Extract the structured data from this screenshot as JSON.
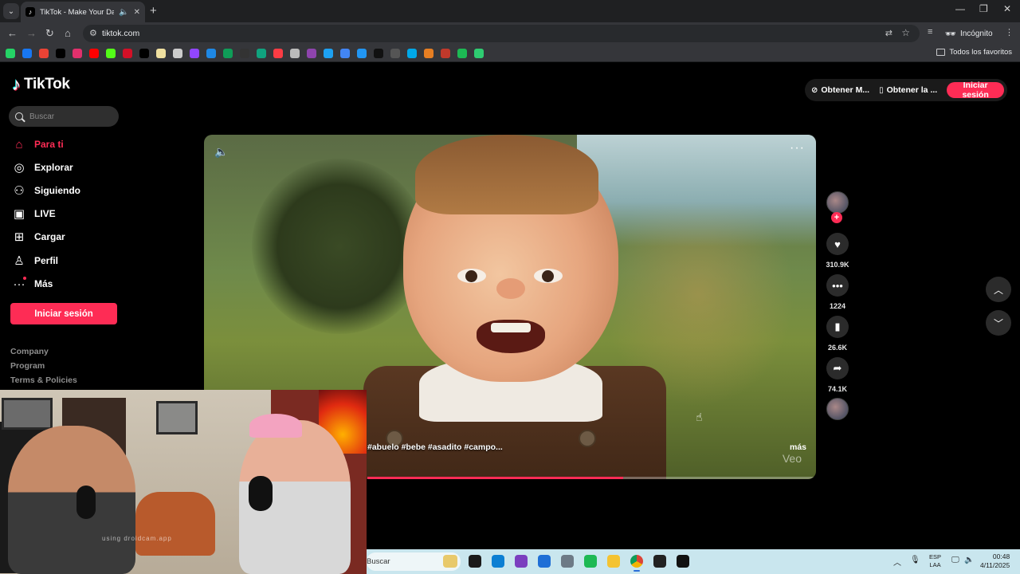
{
  "browser": {
    "tab_title": "TikTok - Make Your Day",
    "url": "tiktok.com",
    "profile_label": "Incógnito",
    "all_bookmarks_label": "Todos los favoritos",
    "bookmark_colors": [
      "#25d366",
      "#1877f2",
      "#ea4335",
      "#000000",
      "#e1306c",
      "#ff0000",
      "#53fc18",
      "#d31027",
      "#000000",
      "#f0e0a0",
      "#cccccc",
      "#9146ff",
      "#1e88e5",
      "#0f9d58",
      "#333333",
      "#10a37f",
      "#fc3c44",
      "#bbbbbb",
      "#8e44ad",
      "#1da1f2",
      "#4285f4",
      "#2196f3",
      "#111111",
      "#555555",
      "#00a8e8",
      "#e67e22",
      "#c0392b",
      "#1db954",
      "#2ecc71"
    ]
  },
  "tiktok": {
    "brand": "TikTok",
    "search_placeholder": "Buscar",
    "menu": [
      {
        "label": "Para ti",
        "icon": "home-icon"
      },
      {
        "label": "Explorar",
        "icon": "compass-icon"
      },
      {
        "label": "Siguiendo",
        "icon": "following-icon"
      },
      {
        "label": "LIVE",
        "icon": "live-icon"
      },
      {
        "label": "Cargar",
        "icon": "upload-icon"
      },
      {
        "label": "Perfil",
        "icon": "profile-icon"
      },
      {
        "label": "Más",
        "icon": "more-icon"
      }
    ],
    "login_label": "Iniciar sesión",
    "footer_links": [
      "Company",
      "Program",
      "Terms & Policies"
    ],
    "top_actions": {
      "coins_label": "Obtener M...",
      "app_label": "Obtener la ...",
      "login_label": "Iniciar sesión"
    },
    "video": {
      "caption": "#abuelo #bebe #asadito #campo...",
      "more_label": "más",
      "watermark": "Veo",
      "progress_fraction": 0.57
    },
    "stats": {
      "likes": "310.9K",
      "comments": "1224",
      "saves": "26.6K",
      "shares": "74.1K"
    }
  },
  "webcam": {
    "watermark": "using droidcam.app"
  },
  "taskbar": {
    "search_placeholder": "Buscar",
    "apps": [
      {
        "name": "task-view",
        "color": "#1a1a1a"
      },
      {
        "name": "edge",
        "color": "#0c7fd3"
      },
      {
        "name": "visual-studio",
        "color": "#7b3fbf"
      },
      {
        "name": "store",
        "color": "#1f6fd6"
      },
      {
        "name": "settings",
        "color": "#6d7a86"
      },
      {
        "name": "spotify",
        "color": "#1db954"
      },
      {
        "name": "file-explorer",
        "color": "#f4c331"
      },
      {
        "name": "chrome",
        "color": "#db4437"
      },
      {
        "name": "app-dark",
        "color": "#222222"
      },
      {
        "name": "app-black",
        "color": "#111111"
      }
    ],
    "lang_top": "ESP",
    "lang_bottom": "LAA",
    "time": "00:48",
    "date": "4/11/2025"
  }
}
